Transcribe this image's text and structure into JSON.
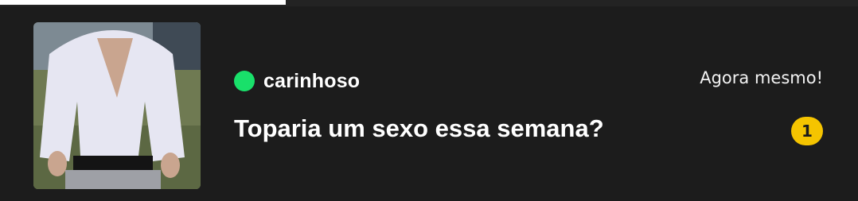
{
  "story": {
    "progress": 0.333
  },
  "notification": {
    "avatar_icon": "profile-photo",
    "status": "online",
    "status_color": "#19e06a",
    "sender_name": "carinhoso",
    "timestamp": "Agora mesmo!",
    "message": "Toparia um sexo essa semana?",
    "unread_count": "1",
    "badge_color": "#f5c400"
  }
}
